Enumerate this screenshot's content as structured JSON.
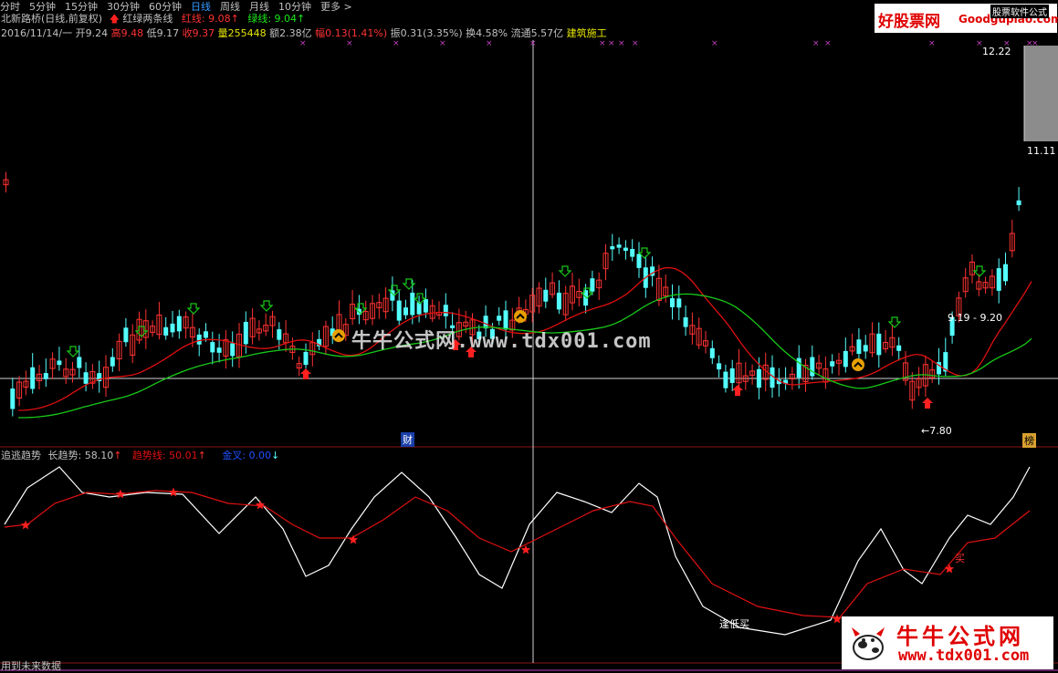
{
  "tabs": [
    "分时",
    "5分钟",
    "15分钟",
    "30分钟",
    "60分钟",
    "日线",
    "周线",
    "月线",
    "10分钟",
    "更多 >"
  ],
  "active_tab": "日线",
  "header": {
    "stock_name": "北新路桥(日线,前复权)",
    "indicator_name": "红绿两条线",
    "red_line_label": "红线: 9.08",
    "green_line_label": "绿线: 9.04",
    "info": {
      "date": "2016/11/14/一",
      "open": "开9.24",
      "high": "高9.48",
      "low": "低9.17",
      "close": "收9.37",
      "volume": "量255448",
      "amount": "额2.38亿",
      "change": "幅0.13(1.41%)",
      "amplitude": "振0.31(3.35%)",
      "turnover": "换4.58%",
      "float": "流通5.57亿",
      "sector": "建筑施工"
    }
  },
  "brand": {
    "name": "好股票网",
    "url": "Goodgupiao.com",
    "link": "股票软件公式"
  },
  "price_labels": {
    "top": "12.22",
    "latest": "11.11",
    "range": "9.19 - 9.20",
    "low": "7.80"
  },
  "markers": {
    "cai": "财",
    "bang": "榜"
  },
  "watermark": "牛牛公式网.www.tdx001.com",
  "lower_panel": {
    "title": "追逃趋势",
    "long_trend": "长趋势: 58.10",
    "trend_line": "趋势线: 50.01",
    "golden_cross": "金叉: 0.00",
    "annotation_low": "逢低买",
    "annotation_buy": "买"
  },
  "footer": "用到未来数据",
  "logo": {
    "name": "牛牛公式网",
    "url": "www.tdx001.com"
  },
  "colors": {
    "up": "#ff3232",
    "down": "#54ffff",
    "red_ma": "#e01010",
    "green_ma": "#18c818",
    "white_line": "#ffffff",
    "accent": "#3399ff",
    "brand": "#e00000"
  }
}
